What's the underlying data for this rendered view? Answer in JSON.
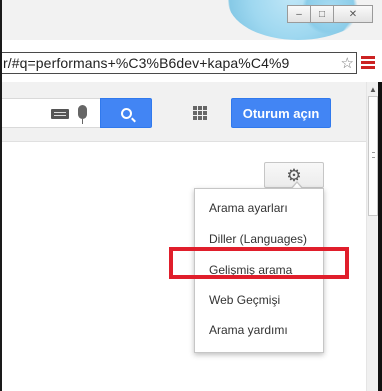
{
  "window": {
    "controls": [
      "–",
      "□",
      "✕"
    ]
  },
  "address_bar": {
    "url": "r/#q=performans+%C3%B6dev+kapa%C4%9",
    "star_icon": "star-icon",
    "menu_icon": "hamburger-menu-icon"
  },
  "header": {
    "keyboard_icon": "keyboard-icon",
    "mic_icon": "mic-icon",
    "search_icon": "search-icon",
    "apps_icon": "apps-grid-icon",
    "signin_label": "Oturum açın"
  },
  "settings": {
    "gear_icon": "gear-icon",
    "menu": [
      {
        "label": "Arama ayarları"
      },
      {
        "label": "Diller  (Languages)"
      },
      {
        "label": "Gelişmiş arama",
        "highlighted": true
      },
      {
        "label": "Web Geçmişi"
      },
      {
        "label": "Arama yardımı"
      }
    ]
  },
  "colors": {
    "accent_blue": "#4285f4",
    "highlight_red": "#e01e2b"
  }
}
